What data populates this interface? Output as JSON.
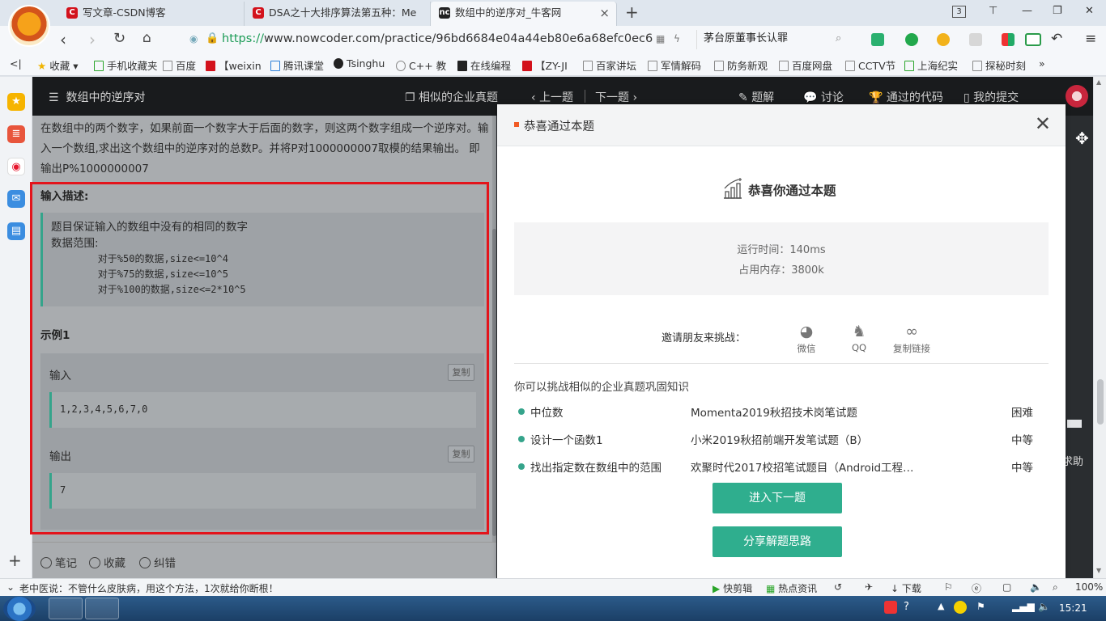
{
  "browser": {
    "tabs": [
      {
        "favicon": "C",
        "title": "写文章-CSDN博客"
      },
      {
        "favicon": "C",
        "title": "DSA之十大排序算法第五种：Me"
      },
      {
        "favicon": "nc",
        "title": "数组中的逆序对_牛客网"
      }
    ],
    "tab_count": "3",
    "url_scheme": "https://",
    "url_rest": "www.nowcoder.com/practice/96bd6684e04a44eb80e6a68efc0ec6",
    "search_text": "茅台原董事长认罪",
    "bookmarks": [
      "收藏",
      "手机收藏夹",
      "百度",
      "【weixin",
      "腾讯课堂",
      "Tsinghu",
      "C++ 教",
      "在线编程",
      "【ZY-JI",
      "百家讲坛",
      "军情解码",
      "防务新观",
      "百度网盘",
      "CCTV节",
      "上海纪实",
      "探秘时刻"
    ]
  },
  "topbar": {
    "title": "数组中的逆序对",
    "similar": "相似的企业真题",
    "prev": "上一题",
    "next": "下一题",
    "solution": "题解",
    "discuss": "讨论",
    "passed_code": "通过的代码",
    "my_submissions": "我的提交"
  },
  "problem": {
    "description": "在数组中的两个数字，如果前面一个数字大于后面的数字，则这两个数字组成一个逆序对。输入一个数组,求出这个数组中的逆序对的总数P。并将P对1000000007取模的结果输出。 即输出P%1000000007",
    "input_title": "输入描述:",
    "input_line1": "题目保证输入的数组中没有的相同的数字",
    "input_line2": "数据范围:",
    "input_line3": "        对于%50的数据,size<=10^4",
    "input_line4": "        对于%75的数据,size<=10^5",
    "input_line5": "        对于%100的数据,size<=2*10^5",
    "example_title": "示例1",
    "input_label": "输入",
    "input_value": "1,2,3,4,5,6,7,0",
    "output_label": "输出",
    "output_value": "7",
    "copy_label": "复制"
  },
  "bottom": {
    "notes": "笔记",
    "favorite": "收藏",
    "correct": "纠错"
  },
  "side_right": {
    "help": "求助"
  },
  "modal": {
    "header": "恭喜通过本题",
    "success": "恭喜你通过本题",
    "runtime": "运行时间：140ms",
    "memory": "占用内存：3800k",
    "invite_label": "邀请朋友来挑战：",
    "share": [
      {
        "icon": "wechat-icon",
        "label": "微信"
      },
      {
        "icon": "qq-icon",
        "label": "QQ"
      },
      {
        "icon": "link-icon",
        "label": "复制链接"
      }
    ],
    "related_title": "你可以挑战相似的企业真题巩固知识",
    "related": [
      {
        "name": "中位数",
        "source": "Momenta2019秋招技术岗笔试题",
        "level": "困难"
      },
      {
        "name": "设计一个函数1",
        "source": "小米2019秋招前端开发笔试题（B）",
        "level": "中等"
      },
      {
        "name": "找出指定数在数组中的范围",
        "source": "欢聚时代2017校招笔试题目（Android工程…",
        "level": "中等"
      }
    ],
    "next_button": "进入下一题",
    "share_button": "分享解题思路"
  },
  "statusbar": {
    "ad": "老中医说：不管什么皮肤病，用这个方法，1次就给你断根！",
    "quick_cut": "快剪辑",
    "hot_news": "热点资讯",
    "download": "下载",
    "zoom": "100%"
  },
  "taskbar": {
    "time": "15:21"
  }
}
